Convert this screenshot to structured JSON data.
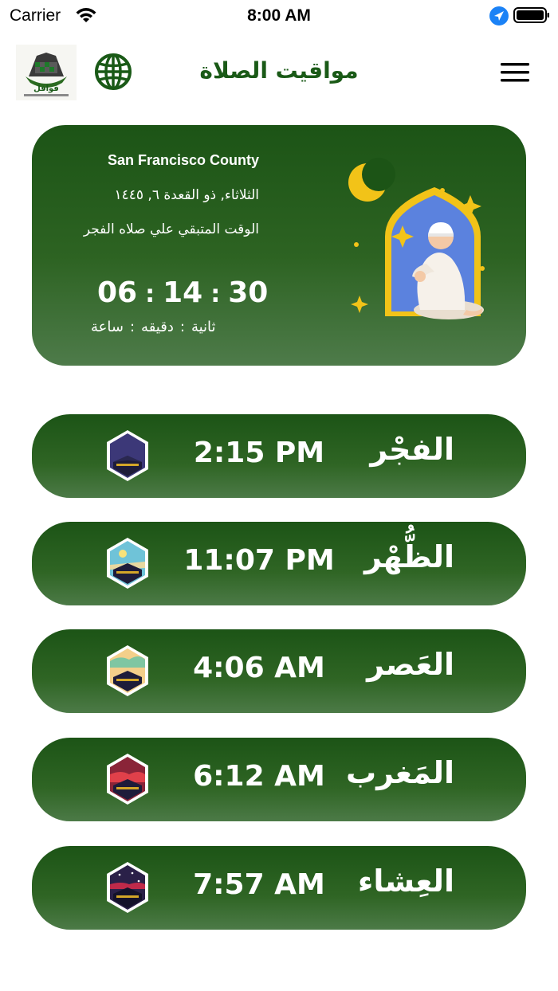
{
  "status_bar": {
    "carrier": "Carrier",
    "time": "8:00 AM"
  },
  "header": {
    "title": "مواقيت الصلاة"
  },
  "next_prayer": {
    "location": "San Francisco County",
    "hijri_date": "الثلاثاء, ذو القعدة ٦, ١٤٤٥",
    "remaining_label": "الوقت المتبقي علي صلاه الفجر",
    "hours": "06",
    "minutes": "14",
    "seconds": "30",
    "unit_hours": "ساعة",
    "unit_minutes": "دقيقه",
    "unit_seconds": "ثانية",
    "separator": ":"
  },
  "prayers": [
    {
      "name": "الفجْر",
      "time": "2:15 PM"
    },
    {
      "name": "الظُّهْر",
      "time": "11:07 PM"
    },
    {
      "name": "العَصر",
      "time": "4:06 AM"
    },
    {
      "name": "المَغرب",
      "time": "6:12 AM"
    },
    {
      "name": "العِشاء",
      "time": "7:57 AM"
    }
  ],
  "colors": {
    "brand_green": "#1a5a17",
    "card_top": "#1c5416",
    "card_bottom": "#4e7b4a",
    "accent_gold": "#f2c318",
    "ios_blue": "#1b82f6"
  },
  "icons": [
    "wifi-icon",
    "location-icon",
    "battery-icon",
    "logo",
    "globe-icon",
    "menu-icon",
    "prayer-illustration",
    "kaaba-fajr-icon",
    "kaaba-dhuhr-icon",
    "kaaba-asr-icon",
    "kaaba-maghrib-icon",
    "kaaba-isha-icon"
  ]
}
